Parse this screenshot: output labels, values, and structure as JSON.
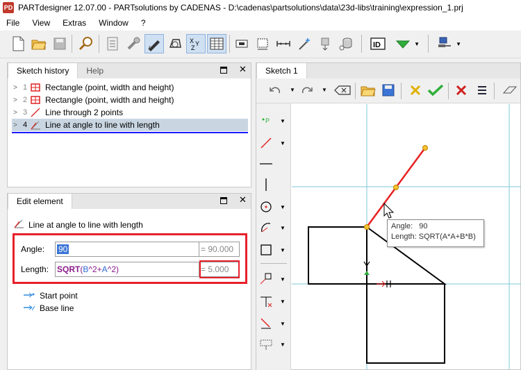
{
  "window": {
    "app_icon_text": "PD",
    "title": "PARTdesigner 12.07.00 - PARTsolutions by CADENAS - D:\\cadenas\\partsolutions\\data\\23d-libs\\training\\expression_1.prj"
  },
  "menu": [
    "File",
    "View",
    "Extras",
    "Window",
    "?"
  ],
  "sketch_history": {
    "tabs": [
      "Sketch history",
      "Help"
    ],
    "rows": [
      {
        "num": "1",
        "label": "Rectangle (point, width and height)"
      },
      {
        "num": "2",
        "label": "Rectangle (point, width and height)"
      },
      {
        "num": "3",
        "label": "Line through 2 points"
      },
      {
        "num": "4",
        "label": "Line at angle to line with length"
      }
    ]
  },
  "edit_element": {
    "tab": "Edit element",
    "element_title": "Line at angle to line with length",
    "angle_label": "Angle:",
    "angle_value": "90",
    "angle_result": "= 90.000",
    "length_label": "Length:",
    "length_expr": {
      "fn": "SQRT",
      "open": "(",
      "a": "B",
      "mid": "^2+",
      "b": "A",
      "end": "^2)"
    },
    "length_result": "= 5.000",
    "references": [
      "Start point",
      "Base line"
    ]
  },
  "sketch": {
    "tab": "Sketch 1",
    "tooltip": {
      "angle_label": "Angle:",
      "angle_value": "90",
      "length_label": "Length:",
      "length_value": "SQRT(A*A+B*B)"
    }
  },
  "colors": {
    "highlight_box": "#e8202a",
    "selection_underline": "#1a1aff",
    "selected_row": "#c9d6e2",
    "construction_line": "#e82020",
    "grid_line": "#7ec8d8"
  }
}
